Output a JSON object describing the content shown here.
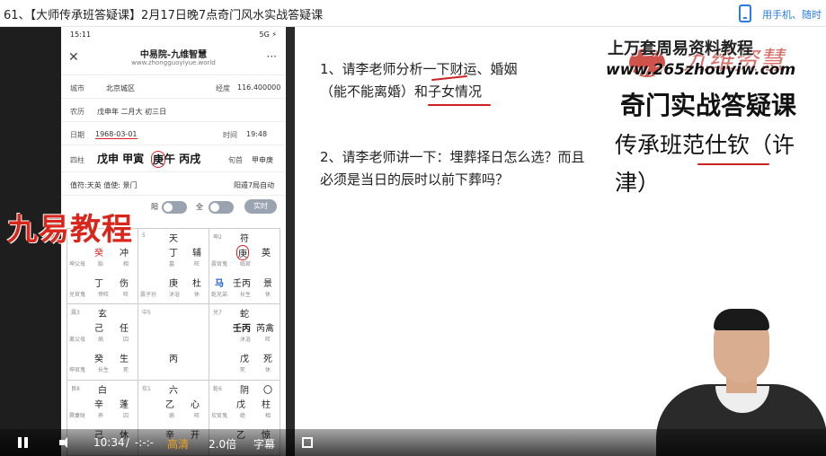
{
  "header": {
    "title": "61、【大师传承班答疑课】2月17日晚7点奇门风水实战答疑课",
    "mobile_link": "用手机、随时"
  },
  "phone": {
    "status_time": "15:11",
    "status_right": "5G ⚡",
    "app_name": "中易院-九维智慧",
    "app_url": "www.zhongguoyiyue.world",
    "city_label": "城市",
    "city_value": "北京城区",
    "lng_label": "经度",
    "lng_value": "116.400000",
    "lunar_label": "农历",
    "lunar_value": "戊申年 二月大 初三日",
    "date_label": "日期",
    "date_value": "1968-03-01",
    "time_label": "时间",
    "time_value": "19:48",
    "pillars_label": "四柱",
    "pillars_value_pre": "戊申 甲寅",
    "pillars_circled": "庚",
    "pillars_value_post": "午 丙戌",
    "xun_label": "旬首",
    "xun_value": "甲申庚",
    "zhifu_text": "值符:天英 值使: 景门",
    "ju_text": "阳遁7局自动",
    "toggle_label_1": "阳",
    "toggle_label_2": "全",
    "realtime_label": "实时"
  },
  "palaces": [
    {
      "top_s": "",
      "top_t": "",
      "c": [
        [
          "癸",
          "冲"
        ],
        [
          "丁",
          "伤"
        ]
      ],
      "s": [
        [
          "坤父母",
          "胎",
          "相"
        ],
        [
          "兑官鬼",
          "帝旺",
          "旺"
        ]
      ]
    },
    {
      "top_s": "5",
      "top_t": "天",
      "c": [
        [
          "丁",
          "辅"
        ],
        [
          "庚",
          "杜"
        ]
      ],
      "s": [
        [
          "",
          "墓",
          "旺"
        ],
        [
          "震子孙",
          "沐浴",
          "休"
        ]
      ]
    },
    {
      "top_s": "坤2",
      "top_t": "符",
      "c": [
        [
          "庚",
          "英"
        ],
        [
          "壬丙",
          "景"
        ]
      ],
      "s": [
        [
          "震官鬼",
          "临官",
          "旺"
        ],
        [
          "乾兄弟",
          "长生",
          "休"
        ]
      ]
    },
    {
      "top_s": "震3",
      "top_t": "玄",
      "c": [
        [
          "己",
          "任"
        ],
        [
          "癸",
          "生"
        ]
      ],
      "s": [
        [
          "离父母",
          "病",
          "囚"
        ],
        [
          "坤官鬼",
          "长生",
          "死"
        ]
      ]
    },
    {
      "top_s": "中5",
      "top_t": "",
      "c": [
        [
          "",
          ""
        ],
        [
          "丙",
          ""
        ]
      ],
      "s": [
        [
          "",
          "",
          ""
        ],
        [
          "",
          "",
          ""
        ]
      ]
    },
    {
      "top_s": "兑7",
      "top_t": "蛇",
      "c": [
        [
          "壬丙",
          "芮禽"
        ],
        [
          "戊",
          "死"
        ]
      ],
      "s": [
        [
          "",
          "沐浴",
          "旺"
        ],
        [
          "",
          "死",
          "休"
        ]
      ]
    },
    {
      "top_s": "艮8",
      "top_t": "白",
      "c": [
        [
          "辛",
          "蓬"
        ],
        [
          "己",
          "休"
        ]
      ],
      "s": [
        [
          "巽妻财",
          "养",
          "囚"
        ],
        [
          "",
          "",
          ""
        ]
      ]
    },
    {
      "top_s": "坎1",
      "top_t": "六",
      "c": [
        [
          "乙",
          "心"
        ],
        [
          "辛",
          "开"
        ]
      ],
      "s": [
        [
          "",
          "病",
          "旺"
        ],
        [
          "",
          "",
          ""
        ]
      ]
    },
    {
      "top_s": "乾6",
      "top_t": "阴",
      "c": [
        [
          "戊",
          "柱"
        ],
        [
          "乙",
          "惊"
        ]
      ],
      "s": [
        [
          "坎官鬼",
          "绝",
          "相"
        ],
        [
          "",
          "",
          ""
        ]
      ]
    }
  ],
  "extras": {
    "horse_mark": "马",
    "top_right_mark": "〇"
  },
  "slide": {
    "q1_line1": "1、请李老师分析一下财运、婚姻",
    "q1_line2": "（能不能离婚）和子女情况",
    "q2_line1": "2、请李老师讲一下：埋葬择日怎么选？而且",
    "q2_line2": "必须是当日的辰时以前下葬吗？",
    "heading1": "奇门实战答疑课",
    "heading2": "传承班范仕钦（许",
    "heading3": "津）"
  },
  "watermarks": {
    "left_logo_text": "九易教程",
    "top_line": "上万套周易资料教程",
    "url_line": "www.265zhouyiw.com",
    "script": "九维资慧"
  },
  "player": {
    "time": "10:34",
    "separator": "/",
    "duration": "-:-:-",
    "quality": "高清",
    "speed": "2.0倍",
    "subtitles": "字幕"
  },
  "colors": {
    "accent_red": "#d22222",
    "link_blue": "#2a7be4",
    "hd_orange": "#f0a020"
  }
}
